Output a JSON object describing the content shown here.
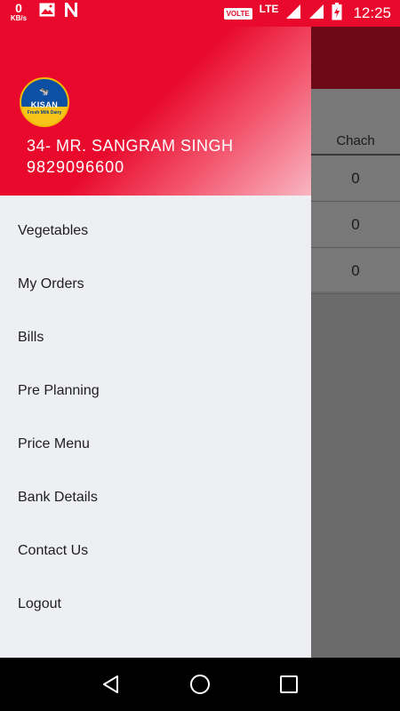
{
  "status_bar": {
    "net_speed_value": "0",
    "net_speed_unit": "KB/s",
    "volte": "VOLTE",
    "network": "LTE",
    "time": "12:25",
    "icons": [
      "image-icon",
      "n-app-icon",
      "wifi-icon",
      "signal-icon",
      "battery-icon"
    ]
  },
  "background_app": {
    "column_header": "Chach",
    "rows": [
      "0",
      "0",
      "0"
    ]
  },
  "drawer": {
    "logo": {
      "brand": "KISAN",
      "tagline": "Fresh Milk Dairy"
    },
    "user_name": "34- MR. SANGRAM SINGH",
    "user_phone": "9829096600",
    "menu": [
      "Vegetables",
      "My Orders",
      "Bills",
      "Pre Planning",
      "Price Menu",
      "Bank Details",
      "Contact Us",
      "Logout"
    ]
  },
  "nav_bar": {
    "icons": [
      "back-icon",
      "home-icon",
      "recents-icon"
    ]
  },
  "colors": {
    "accent": "#e8092c",
    "toolbar_dimmed": "#6c0a18",
    "drawer_bg": "#eeeff3"
  }
}
